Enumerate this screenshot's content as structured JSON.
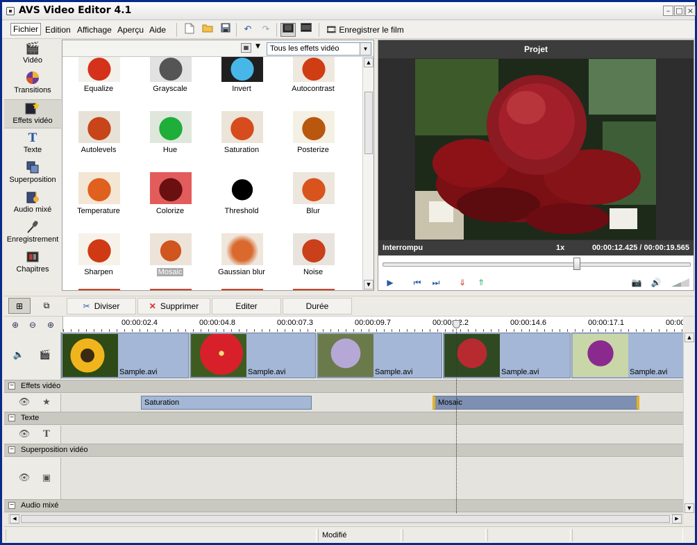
{
  "window": {
    "title": "AVS Video Editor 4.1"
  },
  "menu": [
    "Fichier",
    "Edition",
    "Affichage",
    "Aperçu",
    "Aide"
  ],
  "toolbar": {
    "save_movie": "Enregistrer le film",
    "aspect_43": "4:3",
    "aspect_169": "16:9"
  },
  "sidebar": [
    {
      "label": "Vidéo",
      "icon": "video-film-icon"
    },
    {
      "label": "Transitions",
      "icon": "transitions-icon"
    },
    {
      "label": "Effets vidéo",
      "icon": "video-effects-icon"
    },
    {
      "label": "Texte",
      "icon": "text-icon"
    },
    {
      "label": "Superposition",
      "icon": "overlay-icon"
    },
    {
      "label": "Audio mixé",
      "icon": "audio-mix-icon"
    },
    {
      "label": "Enregistrement",
      "icon": "microphone-icon"
    },
    {
      "label": "Chapitres",
      "icon": "chapters-icon"
    }
  ],
  "effects_panel": {
    "filter": "Tous les effets vidéo",
    "effects": [
      "Equalize",
      "Grayscale",
      "Invert",
      "Autocontrast",
      "Autolevels",
      "Hue",
      "Saturation",
      "Posterize",
      "Temperature",
      "Colorize",
      "Threshold",
      "Blur",
      "Sharpen",
      "Mosaic",
      "Gaussian blur",
      "Noise"
    ],
    "selected": "Mosaic"
  },
  "preview": {
    "title": "Projet",
    "status": "Interrompu",
    "speed": "1x",
    "time": "00:00:12.425 / 00:00:19.565",
    "position_fraction": 0.635
  },
  "timeline_toolbar": {
    "split": "Diviser",
    "delete": "Supprimer",
    "edit": "Editer",
    "duration": "Durée"
  },
  "ruler": [
    "00:00:02.4",
    "00:00:04.8",
    "00:00:07.3",
    "00:00:09.7",
    "00:00:12.2",
    "00:00:14.6",
    "00:00:17.1",
    "00:00"
  ],
  "video_clips": [
    "Sample.avi",
    "Sample.avi",
    "Sample.avi",
    "Sample.avi",
    "Sample.avi"
  ],
  "sections": {
    "effects": "Effets vidéo",
    "text": "Texte",
    "overlay": "Superposition vidéo",
    "audio": "Audio mixé"
  },
  "effect_clips": [
    "Saturation",
    "Mosaic"
  ],
  "statusbar": {
    "state": "Modifié"
  }
}
